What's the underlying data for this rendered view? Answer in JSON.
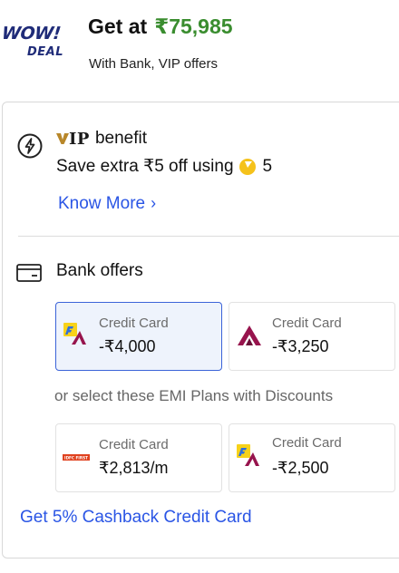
{
  "header": {
    "logo_wow": "WOW!",
    "logo_deal": "DEAL",
    "price_prefix": "Get at",
    "price_amount": "₹75,985",
    "subtitle": "With Bank, VIP offers"
  },
  "vip": {
    "icon": "lightning-circle-icon",
    "brand_text": "IP",
    "title_suffix": "benefit",
    "desc_text": "Save extra ₹5 off using",
    "coin_icon": "supercoin-icon",
    "coin_count": "5",
    "link_label": "Know More",
    "link_chevron": "›"
  },
  "bank_offers": {
    "icon": "credit-card-icon",
    "title": "Bank offers",
    "offers": [
      {
        "label": "Credit Card",
        "value": "-₹4,000",
        "logo": "flipkart-axis-card-icon",
        "selected": true
      },
      {
        "label": "Credit Card",
        "value": "-₹3,250",
        "logo": "axis-bank-icon",
        "selected": false
      }
    ],
    "emi_caption": "or select these EMI Plans with Discounts",
    "emi_plans": [
      {
        "label": "Credit Card",
        "value": "₹2,813/m",
        "logo": "idfc-bank-icon",
        "logo_text": "IDFC FIRST"
      },
      {
        "label": "Credit Card",
        "value": "-₹2,500",
        "logo": "flipkart-axis-card-icon"
      }
    ],
    "cashback_link": "Get 5% Cashback Credit Card"
  },
  "colors": {
    "price_green": "#3a8d2f",
    "link_blue": "#2a55e5",
    "selected_border": "#3b63d8",
    "wow_navy": "#1f2b78"
  }
}
